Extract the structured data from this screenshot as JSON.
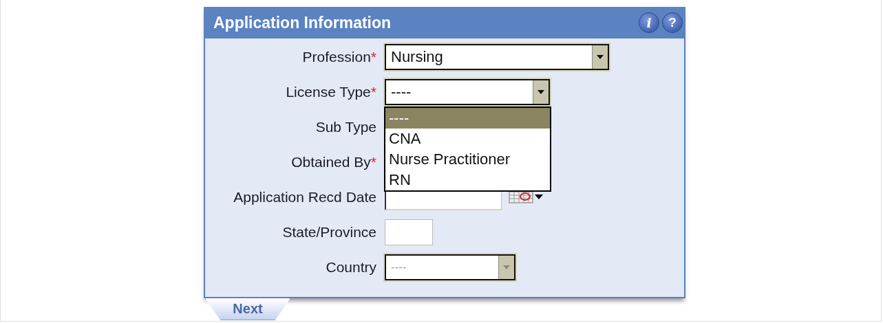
{
  "panel": {
    "title": "Application Information",
    "header_buttons": [
      {
        "kind": "info",
        "label": "i"
      },
      {
        "kind": "help",
        "label": "?"
      }
    ]
  },
  "fields": [
    {
      "label": "Profession",
      "required_mark": "*",
      "kind": "select",
      "value": "Nursing"
    },
    {
      "label": "License Type",
      "required_mark": "*",
      "kind": "select",
      "value": "----",
      "open": true,
      "options": [
        {
          "label": "----",
          "selected": true
        },
        {
          "label": "CNA",
          "selected": false
        },
        {
          "label": "Nurse Practitioner",
          "selected": false
        },
        {
          "label": "RN",
          "selected": false
        }
      ]
    },
    {
      "label": "Sub Type",
      "kind": "hidden"
    },
    {
      "label": "Obtained By",
      "required_mark": "*",
      "kind": "hidden"
    },
    {
      "label": "Application Recd Date",
      "kind": "date"
    },
    {
      "label": "State/Province",
      "kind": "text"
    },
    {
      "label": "Country",
      "kind": "select",
      "value": "----",
      "disabled": true
    }
  ],
  "tabs": [
    {
      "label": "Next"
    }
  ]
}
